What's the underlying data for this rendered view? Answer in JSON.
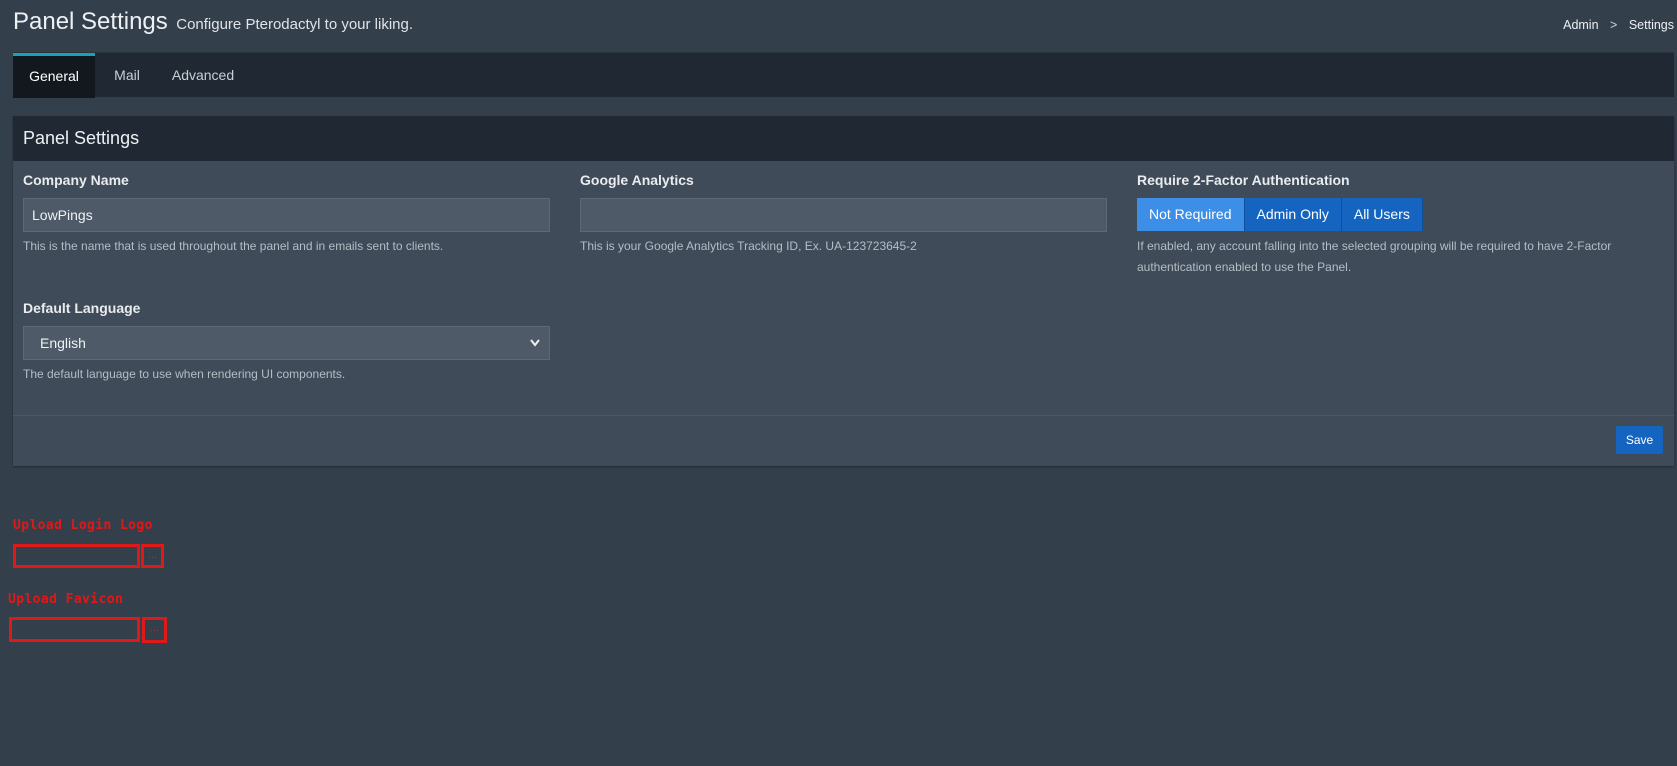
{
  "header": {
    "title": "Panel Settings",
    "subtitle": "Configure Pterodactyl to your liking.",
    "breadcrumb": {
      "admin": "Admin",
      "separator": ">",
      "current": "Settings"
    }
  },
  "tabs": [
    {
      "label": "General",
      "active": true
    },
    {
      "label": "Mail",
      "active": false
    },
    {
      "label": "Advanced",
      "active": false
    }
  ],
  "panel": {
    "title": "Panel Settings",
    "company_name": {
      "label": "Company Name",
      "value": "LowPings",
      "help": "This is the name that is used throughout the panel and in emails sent to clients."
    },
    "google_analytics": {
      "label": "Google Analytics",
      "value": "",
      "help": "This is your Google Analytics Tracking ID, Ex. UA-123723645-2"
    },
    "two_factor": {
      "label": "Require 2-Factor Authentication",
      "options": [
        "Not Required",
        "Admin Only",
        "All Users"
      ],
      "selected": "Not Required",
      "help_line1": "If enabled, any account falling into the selected grouping will be required to have 2-Factor",
      "help_line2": "authentication enabled to use the Panel."
    },
    "default_language": {
      "label": "Default Language",
      "value": "English",
      "help": "The default language to use when rendering UI components."
    },
    "save_label": "Save"
  },
  "uploads": {
    "login_logo": {
      "label": "Upload Login Logo",
      "button": "..."
    },
    "favicon": {
      "label": "Upload Favicon",
      "button": "..."
    }
  },
  "colors": {
    "accent": "#17a2b8",
    "primary_button": "#1565c0",
    "annotation_red": "#e01818"
  }
}
